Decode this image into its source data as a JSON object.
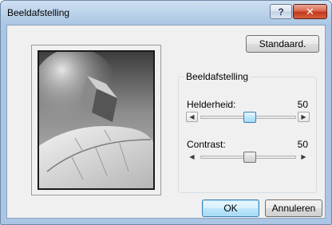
{
  "window": {
    "title": "Beeldafstelling",
    "help_glyph": "?",
    "close_glyph": "✕"
  },
  "toolbar": {
    "default_label": "Standaard."
  },
  "group": {
    "title": "Beeldafstelling"
  },
  "brightness": {
    "label": "Helderheid:",
    "value": "50",
    "left_arrow": "◀",
    "right_arrow": "▶"
  },
  "contrast": {
    "label": "Contrast:",
    "value": "50",
    "left_arrow": "◀",
    "right_arrow": "▶"
  },
  "footer": {
    "ok_label": "OK",
    "cancel_label": "Annuleren"
  },
  "colors": {
    "title_gradient_top": "#cfe0f1",
    "title_gradient_bottom": "#aac6e4",
    "close_red": "#c0391d",
    "default_button_blue": "#3c7fb1",
    "client_bg": "#f0f0f0"
  },
  "icons": {
    "help": "help-icon",
    "close": "close-icon",
    "left_arrow": "arrow-left-icon",
    "right_arrow": "arrow-right-icon"
  }
}
